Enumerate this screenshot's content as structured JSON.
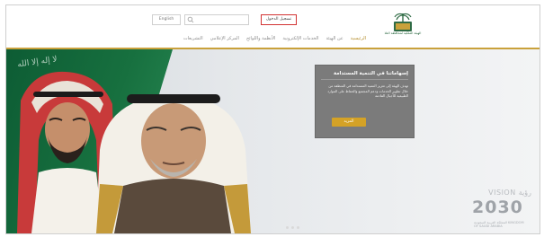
{
  "header": {
    "logo_caption": "الهيئة الملكية لمحافظة العلا",
    "lang_label": "English",
    "search_placeholder": "",
    "login_label": "تسجيل الدخول",
    "nav": [
      {
        "label": "الرئيسية",
        "active": true
      },
      {
        "label": "عن الهيئة",
        "active": false
      },
      {
        "label": "الخدمات الإلكترونية",
        "active": false
      },
      {
        "label": "الأنظمة واللوائح",
        "active": false
      },
      {
        "label": "المركز الإعلامي",
        "active": false
      },
      {
        "label": "التشريعات",
        "active": false
      }
    ],
    "accent_color": "#c9a13b"
  },
  "hero": {
    "info_box": {
      "title": "إسهاماتنا في التنمية المستدامة",
      "body": "تهدف الهيئة إلى تعزيز التنمية المستدامة في المنطقة من خلال تطوير الخدمات ودعم المجتمع والحفاظ على الموارد الطبيعية للأجيال القادمة",
      "button_label": "المزيد"
    },
    "vision": {
      "line1": "VISION رؤية",
      "year": "2030",
      "subtitle": "المملكة العربية السعودية KINGDOM OF SAUDI ARABIA"
    },
    "flag_script": "لا إله إلا الله"
  }
}
